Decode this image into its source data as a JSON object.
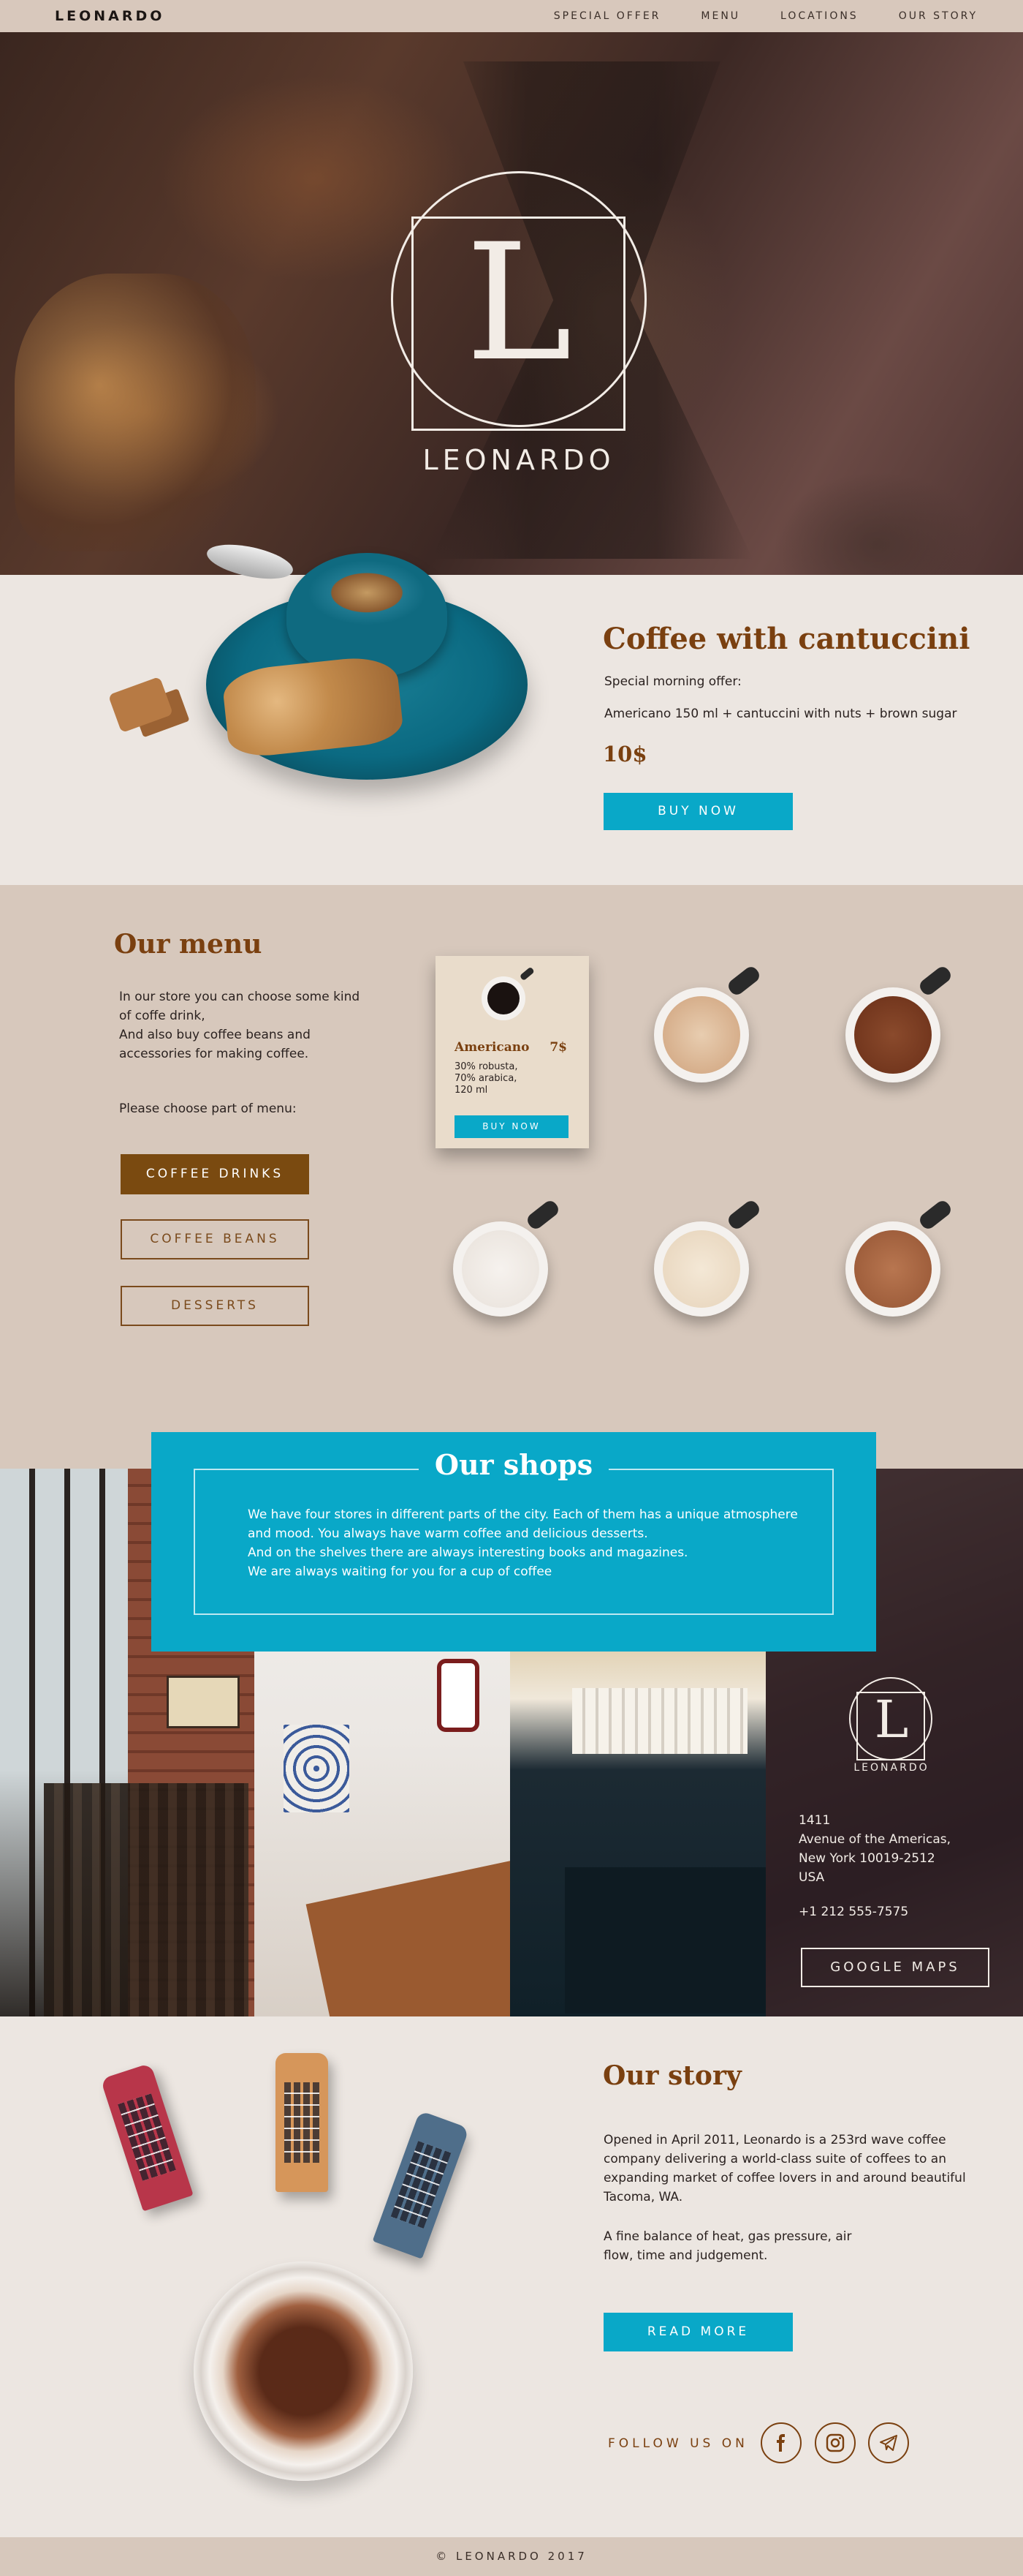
{
  "nav": {
    "brand": "LEONARDO",
    "links": [
      "SPECIAL OFFER",
      "MENU",
      "LOCATIONS",
      "OUR STORY"
    ]
  },
  "hero": {
    "logo_letter": "L",
    "logo_name": "LEONARDO"
  },
  "offer": {
    "title": "Coffee with cantuccini",
    "subtitle": "Special morning offer:",
    "description": "Americano 150 ml + cantuccini with nuts + brown sugar",
    "price": "10$",
    "button": "BUY NOW"
  },
  "menu": {
    "title": "Our menu",
    "intro_1": "In our store you can choose some kind of coffe drink,",
    "intro_2": "And also buy coffee beans and accessories for making coffee.",
    "choose": "Please choose part of menu:",
    "categories": [
      "COFFEE DRINKS",
      "COFFEE BEANS",
      "DESSERTS"
    ],
    "active_category": "COFFEE DRINKS",
    "card": {
      "name": "Americano",
      "price": "7$",
      "ingredients": [
        "30% robusta,",
        "70% arabica,",
        "120 ml"
      ],
      "button": "BUY NOW"
    },
    "colors": {
      "latte": "#d9b89a",
      "mocha": "#7a3c22",
      "milk": "#f1ece6",
      "cream": "#efe2cf",
      "caramel": "#a76645"
    }
  },
  "shops": {
    "title": "Our shops",
    "text": [
      "We have four stores in different parts of the city. Each of them has a unique atmosphere",
      "and mood. You always have warm coffee and delicious desserts.",
      "And on the shelves there are always interesting books and magazines.",
      "We are always waiting for you for a cup of coffee"
    ],
    "logo_letter": "L",
    "logo_name": "LEONARDO",
    "address": [
      "1411",
      "Avenue of the Americas,",
      "New York 10019-2512",
      "USA"
    ],
    "phone": "+1 212 555-7575",
    "maps_button": "GOOGLE MAPS"
  },
  "story": {
    "title": "Our story",
    "paragraph_1": "Opened in April 2011, Leonardo is a 253rd wave coffee company delivering a world-class suite of coffees to an expanding market of coffee lovers in and around beautiful Tacoma, WA.",
    "paragraph_2": "A fine balance of heat, gas pressure, air flow, time and judgement.",
    "button": "READ MORE",
    "follow": "FOLLOW US ON",
    "social_icons": [
      "facebook-icon",
      "instagram-icon",
      "telegram-icon"
    ]
  },
  "footer": {
    "copyright": "© LEONARDO 2017"
  }
}
